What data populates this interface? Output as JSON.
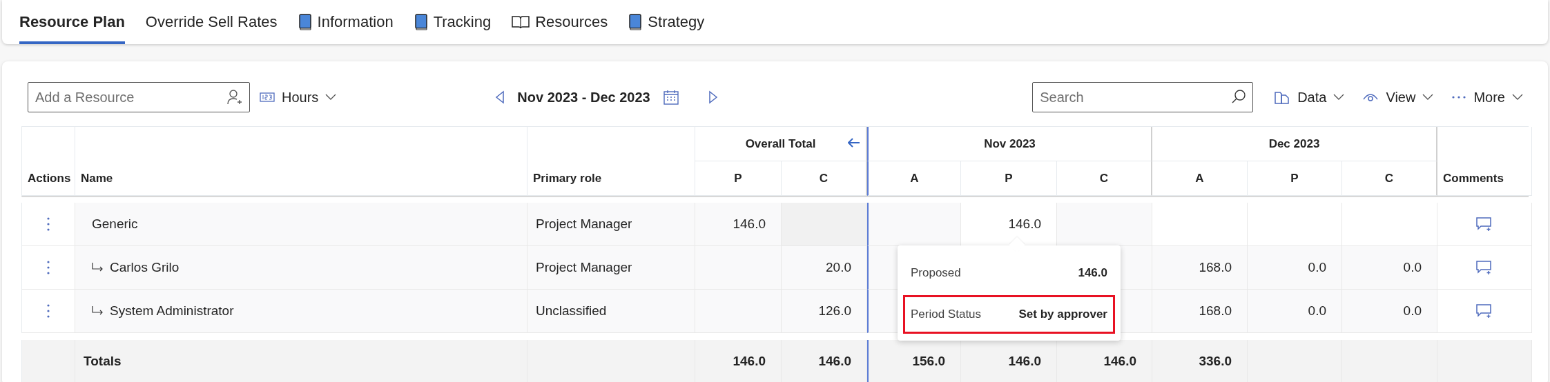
{
  "tabs": [
    {
      "label": "Resource Plan",
      "selected": true,
      "kind": "plain"
    },
    {
      "label": "Override Sell Rates",
      "selected": false,
      "kind": "plain"
    },
    {
      "label": "Information",
      "selected": false,
      "kind": "book"
    },
    {
      "label": "Tracking",
      "selected": false,
      "kind": "book"
    },
    {
      "label": "Resources",
      "selected": false,
      "kind": "open_book"
    },
    {
      "label": "Strategy",
      "selected": false,
      "kind": "book"
    }
  ],
  "toolbar": {
    "add_resource": {
      "placeholder": "Add a Resource"
    },
    "unit": "Hours",
    "period": "Nov 2023 - Dec 2023",
    "search": {
      "placeholder": "Search"
    },
    "menus": [
      "Data",
      "View",
      "More"
    ]
  },
  "table": {
    "columns": {
      "actions": "Actions",
      "name": "Name",
      "role": "Primary role",
      "comments": "Comments"
    },
    "groups": [
      {
        "label": "Overall Total",
        "sub": [
          "P",
          "C"
        ]
      },
      {
        "label": "Nov 2023",
        "sub": [
          "A",
          "P",
          "C"
        ]
      },
      {
        "label": "Dec 2023",
        "sub": [
          "A",
          "P",
          "C"
        ]
      }
    ],
    "rows": [
      {
        "name": "Generic",
        "role": "Project Manager",
        "overall_p": "146.0",
        "nov_p": "146.0",
        "children": [
          {
            "name": "Carlos Grilo",
            "role": "Project Manager",
            "overall_c": "20.0",
            "dec_a": "168.0",
            "dec_p": "0.0",
            "dec_c": "0.0"
          },
          {
            "name": "System Administrator",
            "role": "Unclassified",
            "overall_c": "126.0",
            "dec_a": "168.0",
            "dec_p": "0.0",
            "dec_c": "0.0"
          }
        ]
      }
    ],
    "totals": {
      "label": "Totals",
      "overall_p": "146.0",
      "overall_c": "146.0",
      "nov_a": "156.0",
      "nov_p": "146.0",
      "nov_c": "146.0",
      "dec_a": "336.0"
    }
  },
  "tooltip": {
    "rows": [
      {
        "label": "Proposed",
        "value": "146.0",
        "highlighted": false
      },
      {
        "label": "Period Status",
        "value": "Set by approver",
        "highlighted": true
      }
    ]
  }
}
